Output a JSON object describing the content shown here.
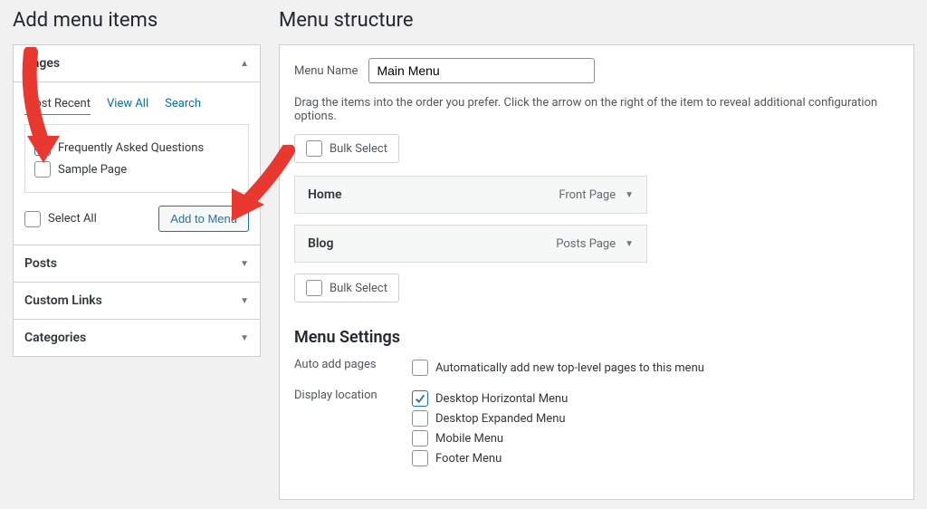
{
  "left": {
    "title": "Add menu items",
    "sections": {
      "pages": {
        "label": "Pages",
        "open": true
      },
      "posts": {
        "label": "Posts"
      },
      "custom": {
        "label": "Custom Links"
      },
      "cats": {
        "label": "Categories"
      }
    },
    "tabs": {
      "recent": "Most Recent",
      "viewall": "View All",
      "search": "Search"
    },
    "pageItems": {
      "faq": {
        "label": "Frequently Asked Questions",
        "checked": true
      },
      "sample": {
        "label": "Sample Page",
        "checked": false
      }
    },
    "selectAll": "Select All",
    "addToMenu": "Add to Menu"
  },
  "right": {
    "title": "Menu structure",
    "nameLabel": "Menu Name",
    "nameValue": "Main Menu",
    "help": "Drag the items into the order you prefer. Click the arrow on the right of the item to reveal additional configuration options.",
    "bulk": "Bulk Select",
    "items": [
      {
        "label": "Home",
        "type": "Front Page"
      },
      {
        "label": "Blog",
        "type": "Posts Page"
      }
    ],
    "settingsTitle": "Menu Settings",
    "autoAdd": {
      "label": "Auto add pages",
      "option": "Automatically add new top-level pages to this menu"
    },
    "display": {
      "label": "Display location",
      "options": [
        {
          "label": "Desktop Horizontal Menu",
          "checked": true
        },
        {
          "label": "Desktop Expanded Menu",
          "checked": false
        },
        {
          "label": "Mobile Menu",
          "checked": false
        },
        {
          "label": "Footer Menu",
          "checked": false
        }
      ]
    }
  }
}
